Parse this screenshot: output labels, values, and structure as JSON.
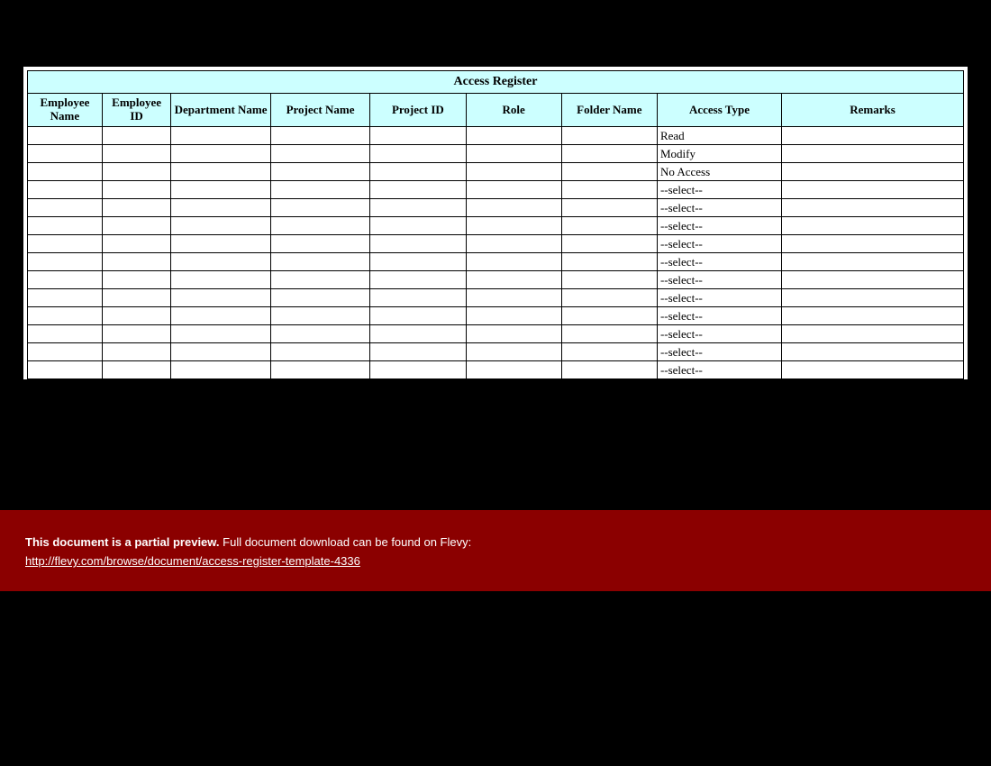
{
  "table": {
    "title": "Access Register",
    "columns": [
      "Employee Name",
      "Employee ID",
      "Department Name",
      "Project Name",
      "Project ID",
      "Role",
      "Folder Name",
      "Access Type",
      "Remarks"
    ],
    "rows": [
      {
        "employee_name": "",
        "employee_id": "",
        "department_name": "",
        "project_name": "",
        "project_id": "",
        "role": "",
        "folder_name": "",
        "access_type": "Read",
        "remarks": ""
      },
      {
        "employee_name": "",
        "employee_id": "",
        "department_name": "",
        "project_name": "",
        "project_id": "",
        "role": "",
        "folder_name": "",
        "access_type": "Modify",
        "remarks": ""
      },
      {
        "employee_name": "",
        "employee_id": "",
        "department_name": "",
        "project_name": "",
        "project_id": "",
        "role": "",
        "folder_name": "",
        "access_type": "No Access",
        "remarks": ""
      },
      {
        "employee_name": "",
        "employee_id": "",
        "department_name": "",
        "project_name": "",
        "project_id": "",
        "role": "",
        "folder_name": "",
        "access_type": "--select--",
        "remarks": ""
      },
      {
        "employee_name": "",
        "employee_id": "",
        "department_name": "",
        "project_name": "",
        "project_id": "",
        "role": "",
        "folder_name": "",
        "access_type": "--select--",
        "remarks": ""
      },
      {
        "employee_name": "",
        "employee_id": "",
        "department_name": "",
        "project_name": "",
        "project_id": "",
        "role": "",
        "folder_name": "",
        "access_type": "--select--",
        "remarks": ""
      },
      {
        "employee_name": "",
        "employee_id": "",
        "department_name": "",
        "project_name": "",
        "project_id": "",
        "role": "",
        "folder_name": "",
        "access_type": "--select--",
        "remarks": ""
      },
      {
        "employee_name": "",
        "employee_id": "",
        "department_name": "",
        "project_name": "",
        "project_id": "",
        "role": "",
        "folder_name": "",
        "access_type": "--select--",
        "remarks": ""
      },
      {
        "employee_name": "",
        "employee_id": "",
        "department_name": "",
        "project_name": "",
        "project_id": "",
        "role": "",
        "folder_name": "",
        "access_type": "--select--",
        "remarks": ""
      },
      {
        "employee_name": "",
        "employee_id": "",
        "department_name": "",
        "project_name": "",
        "project_id": "",
        "role": "",
        "folder_name": "",
        "access_type": "--select--",
        "remarks": ""
      },
      {
        "employee_name": "",
        "employee_id": "",
        "department_name": "",
        "project_name": "",
        "project_id": "",
        "role": "",
        "folder_name": "",
        "access_type": "--select--",
        "remarks": ""
      },
      {
        "employee_name": "",
        "employee_id": "",
        "department_name": "",
        "project_name": "",
        "project_id": "",
        "role": "",
        "folder_name": "",
        "access_type": "--select--",
        "remarks": ""
      },
      {
        "employee_name": "",
        "employee_id": "",
        "department_name": "",
        "project_name": "",
        "project_id": "",
        "role": "",
        "folder_name": "",
        "access_type": "--select--",
        "remarks": ""
      },
      {
        "employee_name": "",
        "employee_id": "",
        "department_name": "",
        "project_name": "",
        "project_id": "",
        "role": "",
        "folder_name": "",
        "access_type": "--select--",
        "remarks": ""
      }
    ]
  },
  "banner": {
    "bold": "This document is a partial preview.",
    "rest": "  Full document download can be found on Flevy:",
    "link": "http://flevy.com/browse/document/access-register-template-4336"
  }
}
